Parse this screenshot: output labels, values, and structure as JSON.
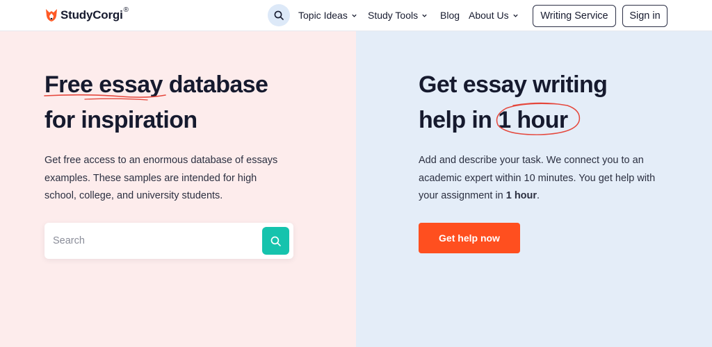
{
  "header": {
    "logo_text": "StudyCorgi",
    "logo_reg": "®",
    "nav": [
      {
        "label": "Topic Ideas",
        "has_dropdown": true
      },
      {
        "label": "Study Tools",
        "has_dropdown": true
      },
      {
        "label": "Blog",
        "has_dropdown": false
      },
      {
        "label": "About Us",
        "has_dropdown": true
      }
    ],
    "writing_service_label": "Writing Service",
    "sign_in_label": "Sign in"
  },
  "left": {
    "title_part1": "Free",
    "title_part2": "essay",
    "title_part3": "database",
    "title_line2": "for inspiration",
    "description": "Get free access to an enormous database of essays examples. These samples are intended for high school, college, and university students.",
    "search_placeholder": "Search"
  },
  "right": {
    "title_line1": "Get essay writing",
    "title_line2_prefix": "help in",
    "title_highlight": "1 hour",
    "description_prefix": "Add and describe your task. We connect you to an academic expert within 10 minutes. You get help with your assignment in ",
    "description_bold": "1 hour",
    "description_suffix": ".",
    "cta_label": "Get help now"
  },
  "colors": {
    "left_bg": "#fdecec",
    "right_bg": "#e4edf8",
    "accent_orange": "#ff4f1f",
    "accent_teal": "#16c3ad",
    "text_dark": "#161a2e",
    "underline_red": "#e5473c"
  },
  "icons": {
    "logo": "corgi-logo-icon",
    "search": "search-icon",
    "chevron": "chevron-down-icon"
  }
}
